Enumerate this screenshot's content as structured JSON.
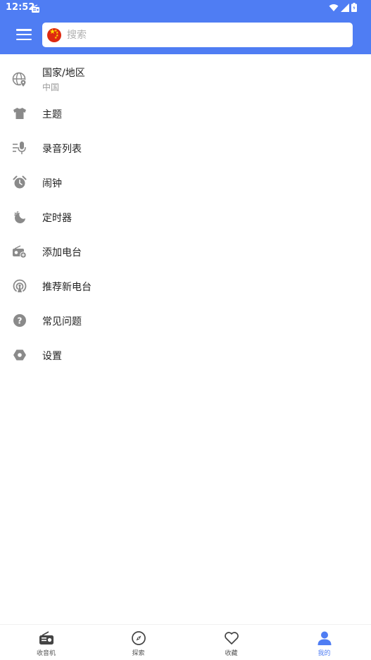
{
  "status_bar": {
    "time": "12:52"
  },
  "header": {
    "menu_icon": "hamburger-menu-icon",
    "search": {
      "placeholder": "搜索",
      "value": "",
      "flag_icon": "china-flag-icon"
    },
    "accent_color": "#4f7df3"
  },
  "menu": {
    "items": [
      {
        "label": "国家/地区",
        "sublabel": "中国",
        "icon": "globe-location-icon"
      },
      {
        "label": "主题",
        "icon": "tshirt-icon"
      },
      {
        "label": "录音列表",
        "icon": "recording-list-icon"
      },
      {
        "label": "闹钟",
        "icon": "alarm-clock-icon"
      },
      {
        "label": "定时器",
        "icon": "sleep-timer-icon"
      },
      {
        "label": "添加电台",
        "icon": "add-radio-icon"
      },
      {
        "label": "推荐新电台",
        "icon": "broadcast-icon"
      },
      {
        "label": "常见问题",
        "icon": "help-circle-icon"
      },
      {
        "label": "设置",
        "icon": "settings-hexagon-icon"
      }
    ]
  },
  "bottom_nav": {
    "tabs": [
      {
        "label": "收音机",
        "icon": "radio-icon",
        "active": false
      },
      {
        "label": "探索",
        "icon": "compass-icon",
        "active": false
      },
      {
        "label": "收藏",
        "icon": "heart-icon",
        "active": false
      },
      {
        "label": "我的",
        "icon": "person-icon",
        "active": true
      }
    ],
    "active_color": "#4f7df3",
    "inactive_color": "#555555"
  }
}
